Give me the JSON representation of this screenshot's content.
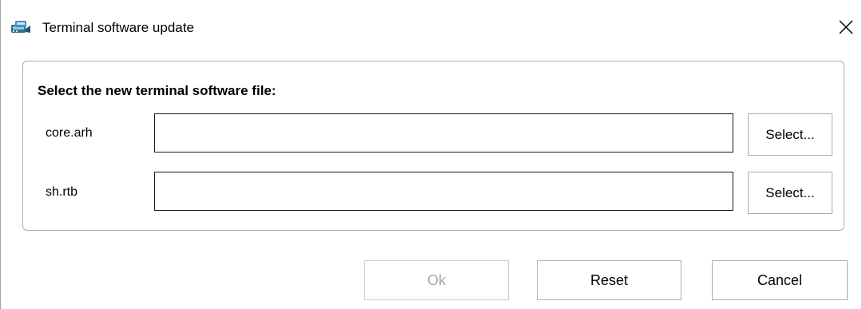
{
  "window": {
    "title": "Terminal software update",
    "icon": "terminal-update-app-icon",
    "close_symbol": "✕"
  },
  "group": {
    "title": "Select the new terminal software file:",
    "rows": [
      {
        "label": "core.arh",
        "value": "",
        "button_label": "Select..."
      },
      {
        "label": "sh.rtb",
        "value": "",
        "button_label": "Select..."
      }
    ]
  },
  "footer": {
    "ok_label": "Ok",
    "ok_enabled": false,
    "reset_label": "Reset",
    "cancel_label": "Cancel"
  }
}
